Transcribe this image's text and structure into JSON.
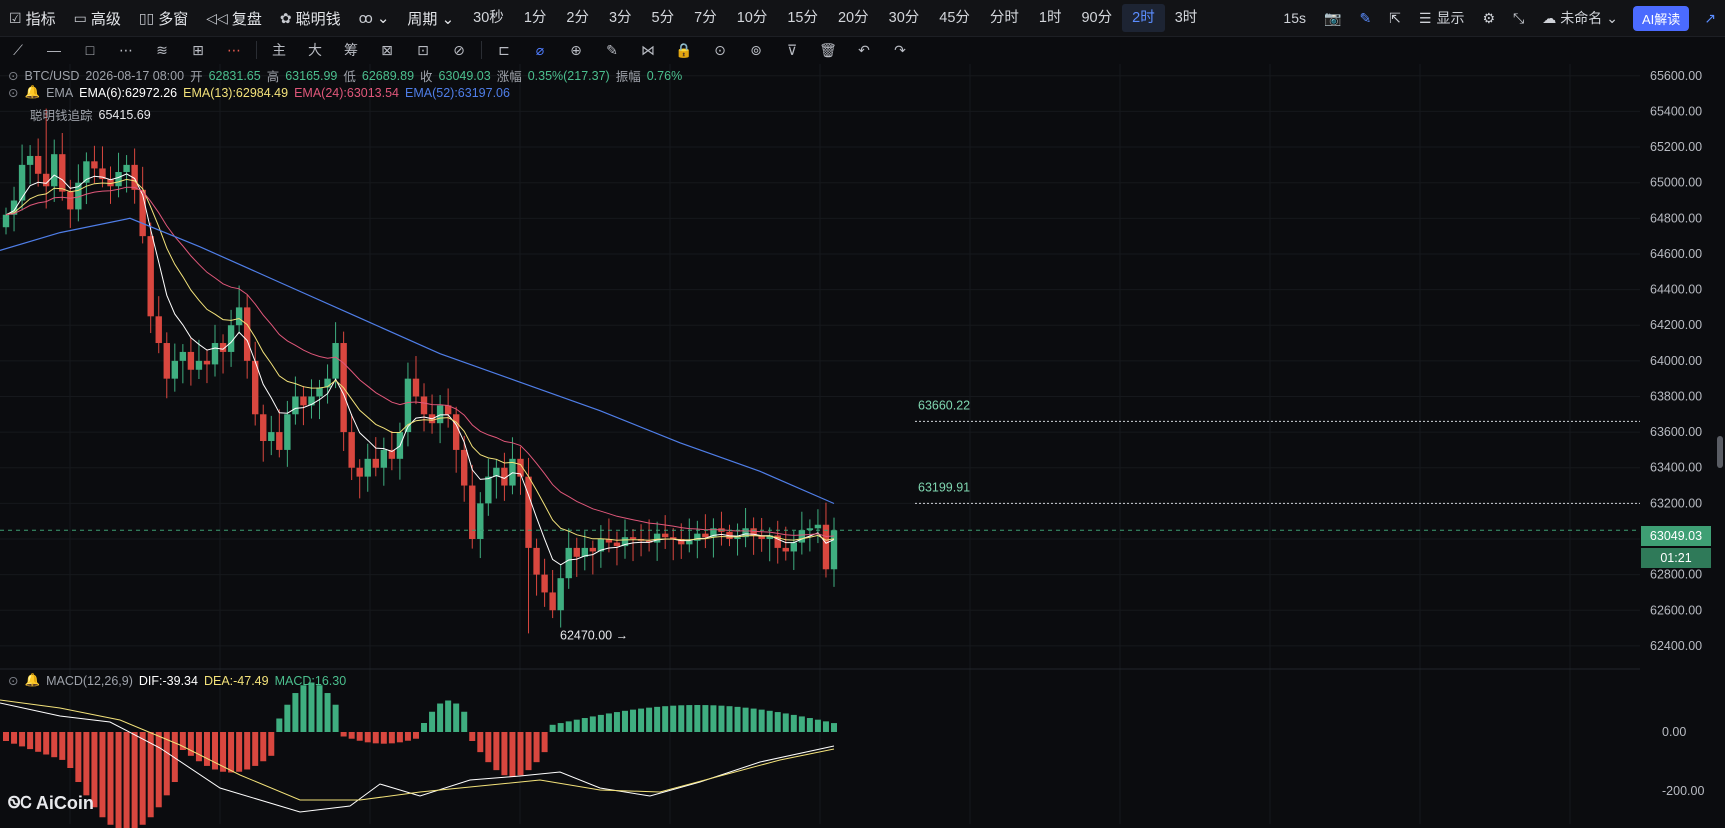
{
  "topbar": {
    "left_items": [
      {
        "icon": "☑",
        "label": "指标",
        "name": "indicators"
      },
      {
        "icon": "▭",
        "label": "高级",
        "name": "advanced"
      },
      {
        "icon": "▯▯",
        "label": "多窗",
        "name": "multi-window"
      },
      {
        "icon": "◁◁",
        "label": "复盘",
        "name": "replay"
      },
      {
        "icon": "✿",
        "label": "聪明钱",
        "name": "smart-money"
      },
      {
        "icon": "ꝏ",
        "label": "⌄",
        "name": "chart-type"
      }
    ],
    "period_label": "周期 ⌄",
    "periods": [
      "30秒",
      "1分",
      "2分",
      "3分",
      "5分",
      "7分",
      "10分",
      "15分",
      "20分",
      "30分",
      "45分",
      "分时",
      "1时",
      "90分",
      "2时",
      "3时"
    ],
    "active_period": "2时",
    "right": {
      "interval": "15s",
      "display": "显示",
      "layout_name": "未命名",
      "ai_label": "AI解读"
    }
  },
  "toolbar": {
    "tools": [
      "⟋",
      "—",
      "□",
      "⋯",
      "≋",
      "⊞",
      "⋯",
      "主",
      "大",
      "筹",
      "⊠",
      "⊡",
      "⊘",
      "⊏",
      "⌀",
      "⊕",
      "✎",
      "⋈",
      "🔒",
      "⊙",
      "⊚",
      "⊽",
      "🗑",
      "↶",
      "↷"
    ]
  },
  "legend": {
    "symbol": "BTC/USD",
    "time": "2026-08-17 08:00",
    "open_label": "开",
    "open": "62831.65",
    "high_label": "高",
    "high": "63165.99",
    "low_label": "低",
    "low": "62689.89",
    "close_label": "收",
    "close": "63049.03",
    "change_label": "涨幅",
    "change": "0.35%(217.37)",
    "amp_label": "振幅",
    "amp": "0.76%",
    "ema_label": "EMA",
    "ema6": "EMA(6):62972.26",
    "ema13": "EMA(13):62984.49",
    "ema24": "EMA(24):63013.54",
    "ema52": "EMA(52):63197.06",
    "smart": "聪明钱追踪",
    "max_label": "65415.69"
  },
  "price_axis": [
    "65600.00",
    "65400.00",
    "65200.00",
    "65000.00",
    "64800.00",
    "64600.00",
    "64400.00",
    "64200.00",
    "64000.00",
    "63800.00",
    "63600.00",
    "63400.00",
    "63200.00",
    "63000.00",
    "62800.00",
    "62600.00",
    "62400.00"
  ],
  "levels": {
    "resistance1": "63660.22",
    "resistance2": "63199.91",
    "low": "62470.00 →"
  },
  "current": {
    "price": "63049.03",
    "countdown": "01:21"
  },
  "macd": {
    "label": "MACD(12,26,9)",
    "dif": "DIF:-39.34",
    "dea": "DEA:-47.49",
    "macd": "MACD:16.30",
    "axis": [
      "0.00",
      "-200.00"
    ]
  },
  "logo": "AiCoin",
  "colors": {
    "up": "#3fae80",
    "down": "#d9473f",
    "ema6": "#ffffff",
    "ema13": "#f3e27a",
    "ema24": "#e0577a",
    "ema52": "#4f7ee8",
    "accent": "#4b6bff"
  }
}
